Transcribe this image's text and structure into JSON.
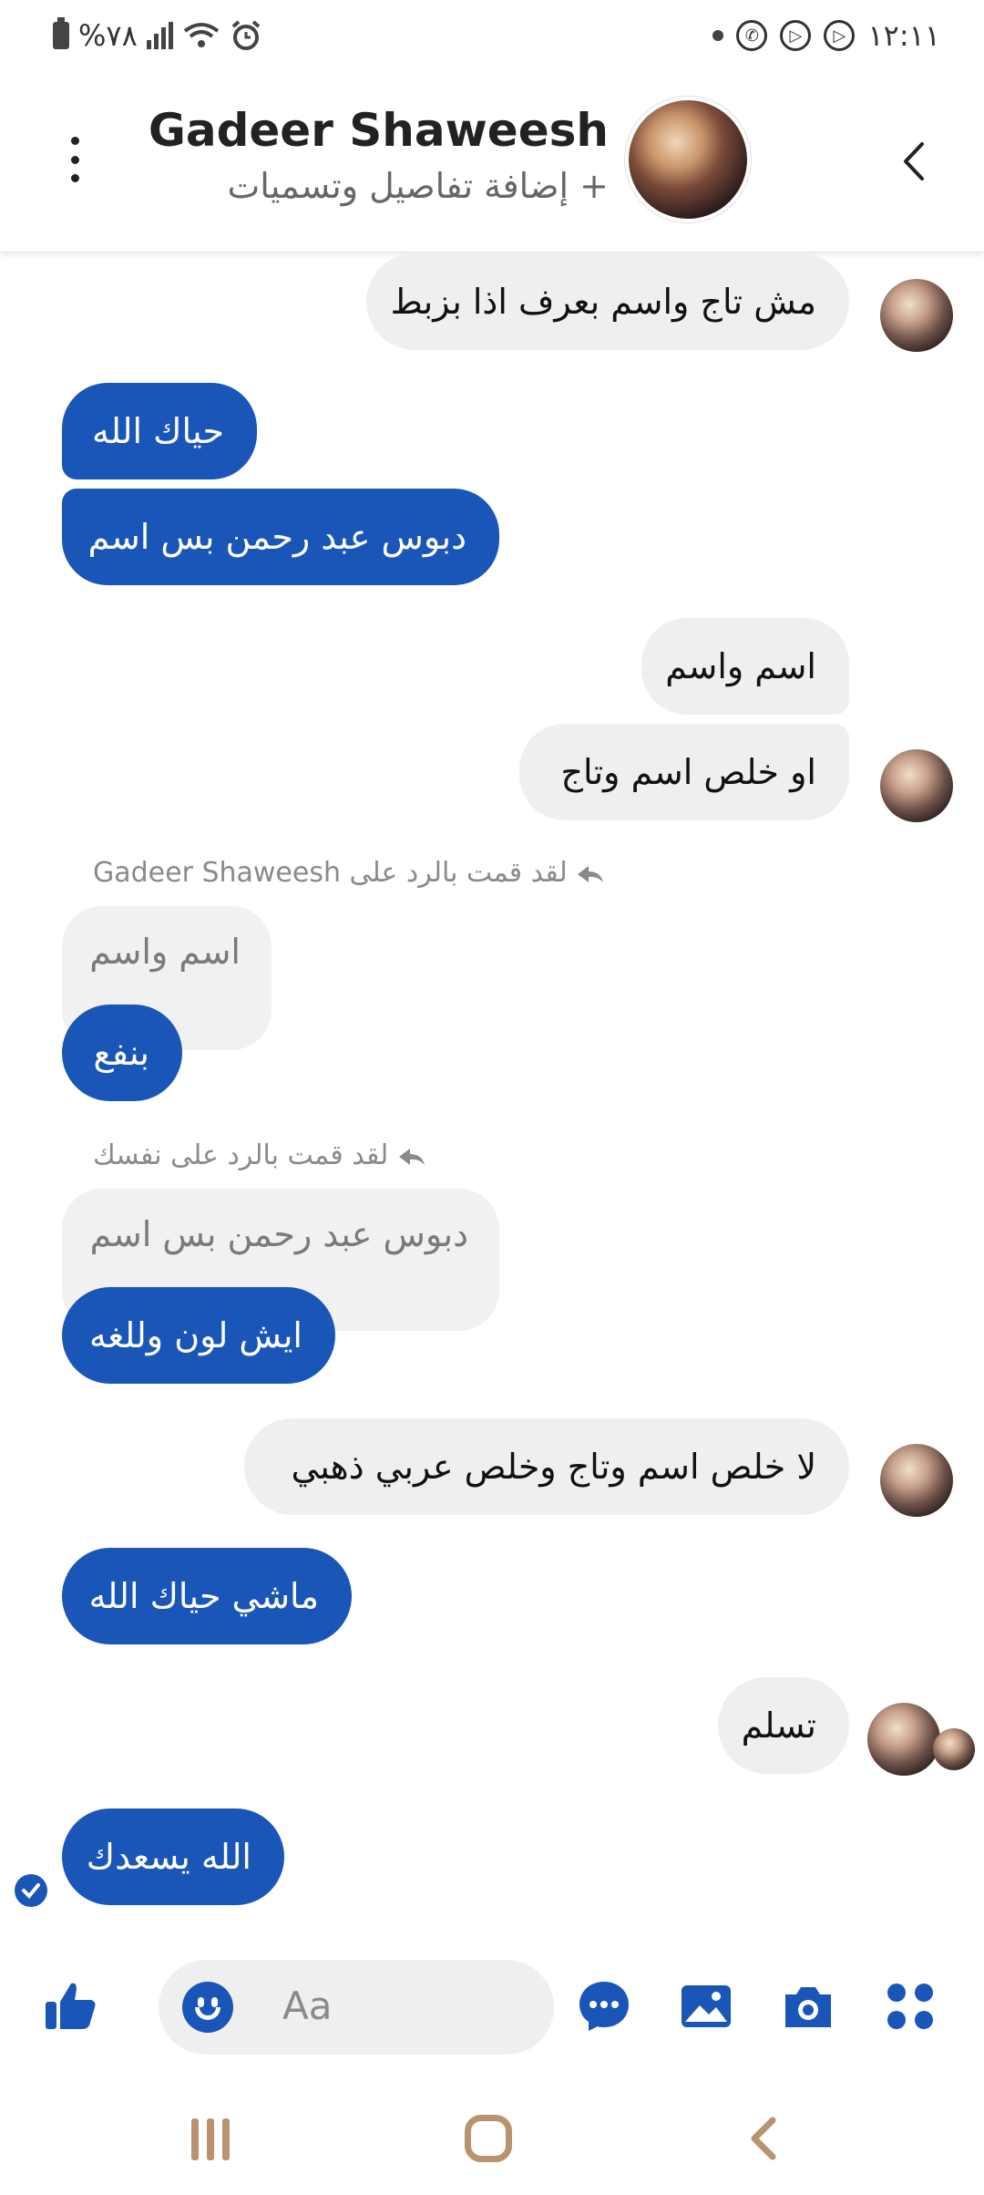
{
  "status_bar": {
    "battery": "%٧٨",
    "time": "١٢:١١"
  },
  "header": {
    "name": "Gadeer Shaweesh",
    "subtitle": "+ إضافة تفاصيل وتسميات"
  },
  "messages": [
    {
      "text": "مش تاج واسم بعرف اذا بزبط",
      "dir": "in"
    },
    {
      "text": "حياك الله",
      "dir": "out"
    },
    {
      "text": "دبوس عبد رحمن بس اسم",
      "dir": "out"
    },
    {
      "text": "اسم واسم",
      "dir": "in"
    },
    {
      "text": "او خلص اسم وتاج",
      "dir": "in"
    },
    {
      "text": "بنفع",
      "dir": "out",
      "reply_note": "لقد قمت بالرد على Gadeer Shaweesh",
      "quoted": "اسم واسم"
    },
    {
      "text": "ايش لون وللغه",
      "dir": "out",
      "reply_note": "لقد قمت بالرد على نفسك",
      "quoted": "دبوس عبد رحمن بس اسم"
    },
    {
      "text": "لا خلص اسم وتاج وخلص عربي ذهبي",
      "dir": "in"
    },
    {
      "text": "ماشي حياك الله",
      "dir": "out"
    },
    {
      "text": "تسلم",
      "dir": "in"
    },
    {
      "text": "الله يسعدك",
      "dir": "out"
    }
  ],
  "composer": {
    "placeholder": "Aa"
  },
  "icons": {
    "like": "thumbs-up-icon",
    "emoji": "emoji-icon",
    "chat": "chat-bubble-icon",
    "gallery": "gallery-icon",
    "camera": "camera-icon",
    "apps": "apps-grid-icon"
  },
  "colors": {
    "accent": "#1a56b8",
    "incoming_bubble": "#efefef"
  }
}
